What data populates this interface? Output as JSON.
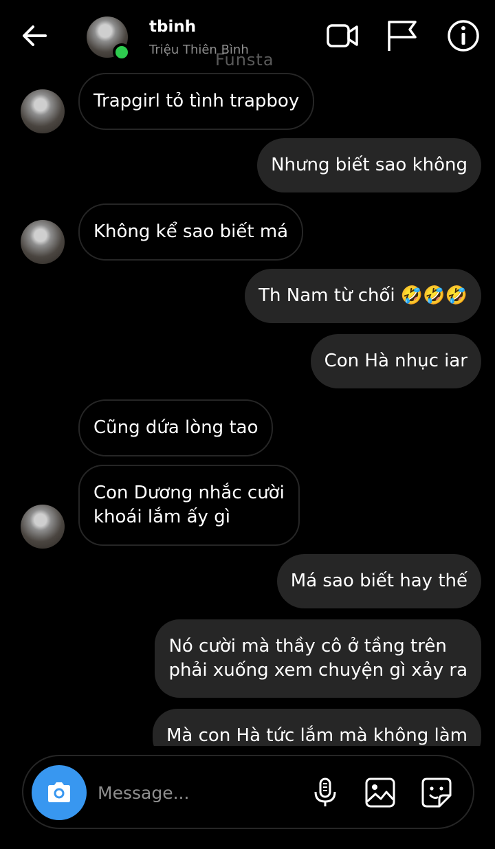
{
  "header": {
    "username": "tbinh",
    "full_name": "Triệu Thiên Bình",
    "watermark": "Funsta",
    "online_color": "#2ecc4f",
    "icons": [
      "back-arrow-icon",
      "video-call-icon",
      "flag-icon",
      "info-icon"
    ]
  },
  "messages": [
    {
      "sender": "them",
      "text": "Trapgirl tỏ tình trapboy"
    },
    {
      "sender": "me",
      "text": "Nhưng biết sao không"
    },
    {
      "sender": "them",
      "text": "Không kể sao biết má"
    },
    {
      "sender": "me",
      "text": "Th Nam từ chối 🤣🤣🤣"
    },
    {
      "sender": "me",
      "text": "Con Hà nhục iar"
    },
    {
      "sender": "them",
      "text": "Cũng dứa lòng tao"
    },
    {
      "sender": "them",
      "text": "Con Dương nhắc cười\nkhoái lắm ấy gì"
    },
    {
      "sender": "me",
      "text": "Má sao biết hay thế"
    },
    {
      "sender": "me",
      "text": "Nó cười mà thầy cô ở tầng trên\nphải xuống xem chuyện gì xảy ra"
    },
    {
      "sender": "me",
      "text": "Mà con Hà tức lắm mà không làm"
    }
  ],
  "composer": {
    "placeholder": "Message...",
    "camera_color": "#3897f0",
    "icons": [
      "camera-icon",
      "microphone-icon",
      "gallery-icon",
      "sticker-icon"
    ]
  }
}
